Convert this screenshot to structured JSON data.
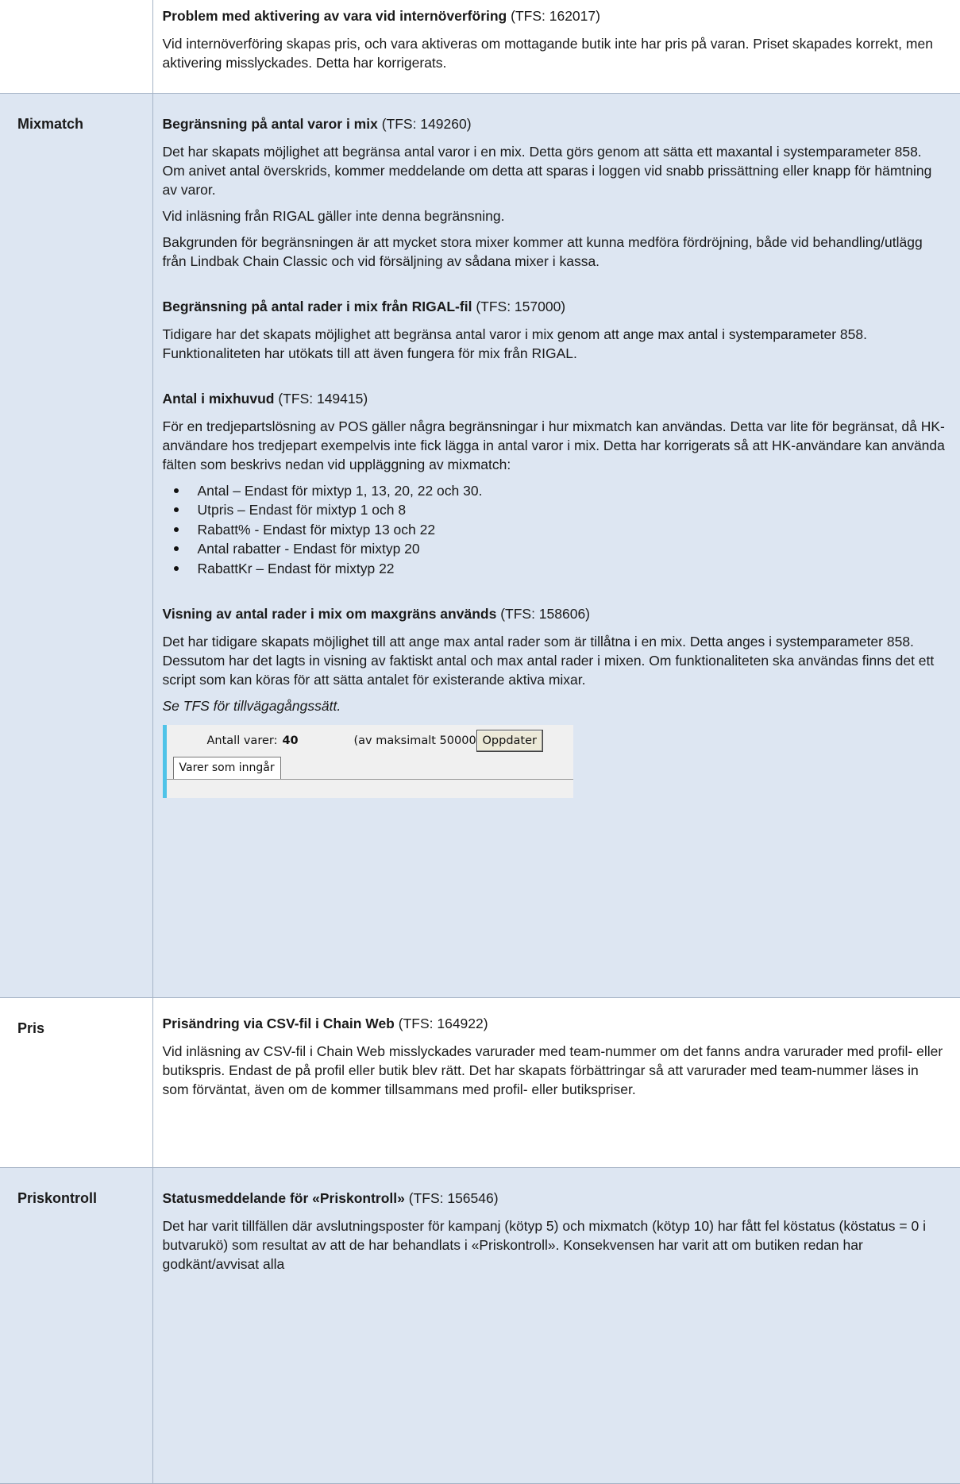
{
  "rows": [
    {
      "category": "",
      "items": [
        {
          "title": "Problem med aktivering av vara vid internöverföring",
          "tfs": "(TFS: 162017)",
          "paragraphs": [
            "Vid internöverföring skapas pris, och vara aktiveras om mottagande butik inte har pris på varan. Priset skapades korrekt, men aktivering misslyckades. Detta har korrigerats."
          ]
        }
      ]
    },
    {
      "category": "Mixmatch",
      "items": [
        {
          "title": "Begränsning på antal varor i mix",
          "tfs": "(TFS: 149260)",
          "paragraphs": [
            "Det har skapats möjlighet att begränsa antal varor i en mix. Detta görs genom att sätta ett maxantal i systemparameter 858. Om anivet antal överskrids, kommer meddelande om detta att sparas i loggen vid snabb prissättning eller knapp för hämtning av varor.",
            "Vid inläsning från RIGAL gäller inte denna begränsning.",
            "Bakgrunden för begränsningen är att mycket stora mixer kommer att kunna medföra fördröjning, både vid behandling/utlägg från Lindbak Chain Classic och vid försäljning av sådana mixer i kassa."
          ]
        },
        {
          "title": "Begränsning på antal rader i mix från RIGAL-fil",
          "tfs": "(TFS: 157000)",
          "paragraphs": [
            "Tidigare har det skapats möjlighet att begränsa antal varor i mix genom att ange max antal i systemparameter 858. Funktionaliteten har utökats till att även fungera för mix från RIGAL."
          ]
        },
        {
          "title": "Antal i mixhuvud",
          "tfs": "(TFS: 149415)",
          "paragraphs": [
            "För en tredjepartslösning av POS gäller några begränsningar i hur mixmatch kan användas. Detta var lite för begränsat, då HK-användare hos tredjepart exempelvis inte fick lägga in antal varor i mix. Detta har korrigerats så att HK-användare kan använda fälten som beskrivs nedan vid uppläggning av mixmatch:"
          ],
          "bullets": [
            "Antal – Endast för mixtyp 1, 13, 20, 22 och 30.",
            "Utpris – Endast för mixtyp 1 och 8",
            "Rabatt% - Endast för mixtyp 13 och 22",
            "Antal rabatter - Endast för mixtyp 20",
            "RabattKr – Endast för mixtyp 22"
          ]
        },
        {
          "title": "Visning av antal rader i mix om maxgräns används",
          "tfs": "(TFS: 158606)",
          "paragraphs": [
            "Det har tidigare skapats möjlighet till att ange max antal rader som är tillåtna i en mix. Detta anges i systemparameter 858. Dessutom har det lagts in visning av faktiskt antal och max antal rader i mixen. Om funktionaliteten ska användas finns det ett script som kan köras för att sätta antalet för existerande aktiva mixar."
          ],
          "note": "Se TFS för tillvägagångssätt.",
          "screenshot": {
            "count_label": "Antall varer:",
            "count_value": "40",
            "max_text": "(av maksimalt 50000)",
            "button_label": "Oppdater",
            "tab_label": "Varer som inngår"
          }
        }
      ]
    },
    {
      "category": "Pris",
      "items": [
        {
          "title": "Prisändring via CSV-fil i Chain Web",
          "tfs": "(TFS: 164922)",
          "paragraphs": [
            "Vid inläsning av CSV-fil i Chain Web misslyckades varurader med team-nummer om det fanns andra varurader med profil- eller butikspris. Endast de på profil eller butik blev rätt. Det har skapats förbättringar så att varurader med team-nummer läses in som förväntat, även om de kommer tillsammans med profil- eller butikspriser."
          ]
        }
      ]
    },
    {
      "category": "Priskontroll",
      "items": [
        {
          "title": "Statusmeddelande för «Priskontroll»",
          "tfs": "(TFS: 156546)",
          "paragraphs": [
            "Det har varit tillfällen där avslutningsposter för kampanj (kötyp 5) och mixmatch (kötyp 10) har fått fel köstatus (köstatus = 0 i butvarukö) som resultat av att de har behandlats i «Priskontroll». Konsekvensen har varit att om butiken redan har godkänt/avvisat alla"
          ]
        }
      ]
    }
  ]
}
